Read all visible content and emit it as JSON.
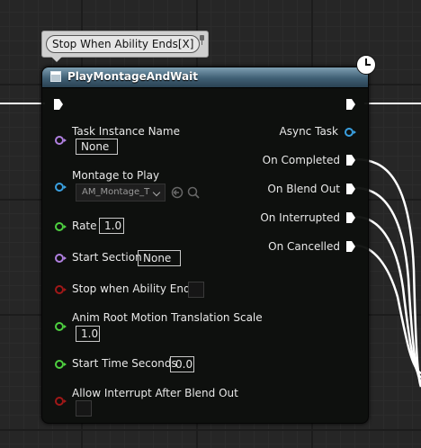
{
  "comment": {
    "text": "Stop When Ability Ends[X]"
  },
  "node": {
    "title": "PlayMontageAndWait",
    "header_color": "#3f5f74"
  },
  "inputs": {
    "task_instance_name": {
      "label": "Task Instance Name",
      "value": "None",
      "pin_color": "#b080e0"
    },
    "montage_to_play": {
      "label": "Montage to Play",
      "value": "AM_Montage_T",
      "pin_color": "#3aa0e0"
    },
    "rate": {
      "label": "Rate",
      "value": "1.0",
      "pin_color": "#4ed040"
    },
    "start_section": {
      "label": "Start Section",
      "value": "None",
      "pin_color": "#b080e0"
    },
    "stop_when_ability_ends": {
      "label": "Stop when Ability Ends",
      "checked": false,
      "pin_color": "#a01818"
    },
    "anim_root_motion_translation_scale": {
      "label": "Anim Root Motion Translation Scale",
      "value": "1.0",
      "pin_color": "#4ed040"
    },
    "start_time_seconds": {
      "label": "Start Time Seconds",
      "value": "0.0",
      "pin_color": "#4ed040"
    },
    "allow_interrupt_after_blend_out": {
      "label": "Allow Interrupt After Blend Out",
      "checked": false,
      "pin_color": "#a01818"
    }
  },
  "outputs": {
    "async_task": {
      "label": "Async Task",
      "pin_color": "#3aa0e0"
    },
    "on_completed": {
      "label": "On Completed"
    },
    "on_blend_out": {
      "label": "On Blend Out"
    },
    "on_interrupted": {
      "label": "On Interrupted"
    },
    "on_cancelled": {
      "label": "On Cancelled"
    }
  },
  "icons": {
    "node": "function-icon",
    "latent": "clock-icon",
    "browse": "arrow-circle-icon",
    "search": "search-icon",
    "comment_pin": "pin-icon"
  },
  "colors": {
    "exec": "#ffffff",
    "wire": "#ffffff",
    "background": "#262626"
  }
}
